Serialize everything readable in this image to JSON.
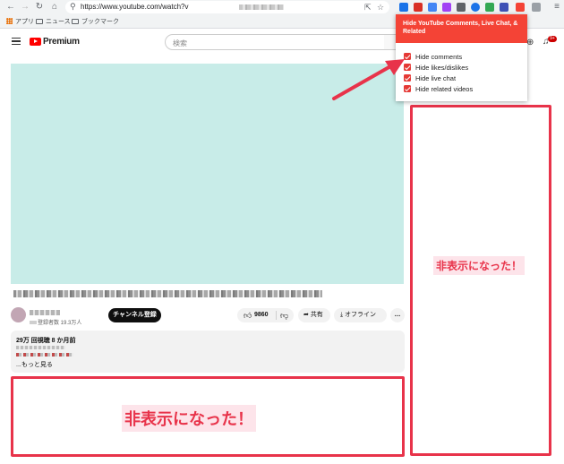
{
  "browser": {
    "url": "https://www.youtube.com/watch?v",
    "bookmarks": [
      "アプリ",
      "ニュース",
      "ブックマーク"
    ],
    "extension_badge": "99+"
  },
  "youtube": {
    "brand": "Premium",
    "search_placeholder": "検索",
    "notification_badge": "9+",
    "video_color": "#c8ece8",
    "subscriber_count": "登録者数 19.3万人",
    "subscribe_label": "チャンネル登録",
    "like_count": "9860",
    "share_label": "共有",
    "offline_label": "オフライン",
    "more_label": "…",
    "views_date": "29万 回視聴  8 か月前",
    "show_more": "...もっと見る"
  },
  "popup": {
    "title": "Hide YouTube Comments, Live Chat, & Related",
    "accent": "#f44336",
    "options": [
      {
        "label": "Hide comments",
        "checked": true
      },
      {
        "label": "Hide likes/dislikes",
        "checked": true
      },
      {
        "label": "Hide live chat",
        "checked": true
      },
      {
        "label": "Hide related videos",
        "checked": true
      }
    ]
  },
  "annotations": {
    "hidden_text": "非表示になった！",
    "box_color": "#e8334a"
  }
}
